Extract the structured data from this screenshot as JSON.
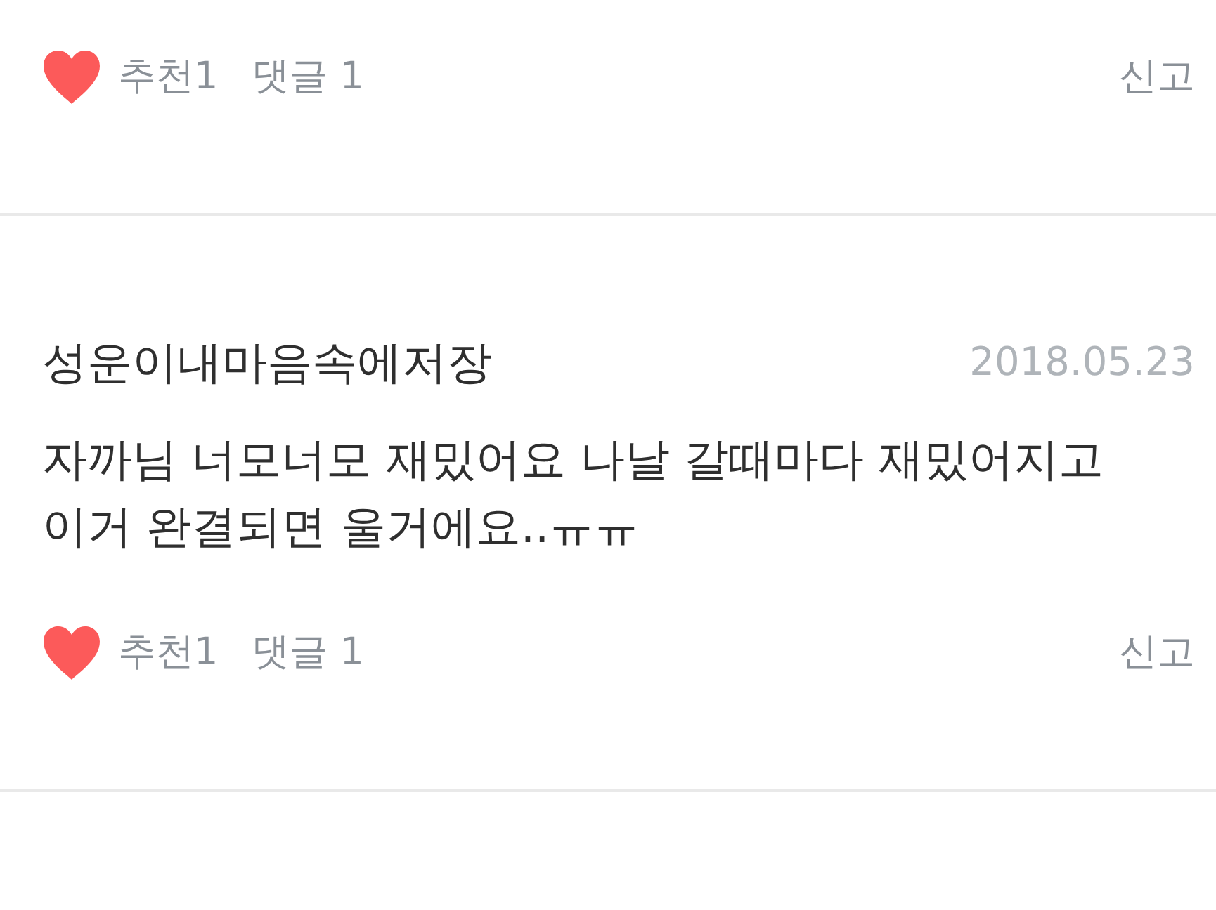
{
  "comments": [
    {
      "like_label": "추천1",
      "reply_label": "댓글 1",
      "report_label": "신고"
    },
    {
      "author": "성운이내마음속에저장",
      "date": "2018.05.23",
      "text": "자까님 너모너모 재밌어요 나날 갈때마다 재밌어지고 이거 완결되면 울거에요..ㅠㅠ",
      "like_label": "추천1",
      "reply_label": "댓글 1",
      "report_label": "신고"
    }
  ]
}
